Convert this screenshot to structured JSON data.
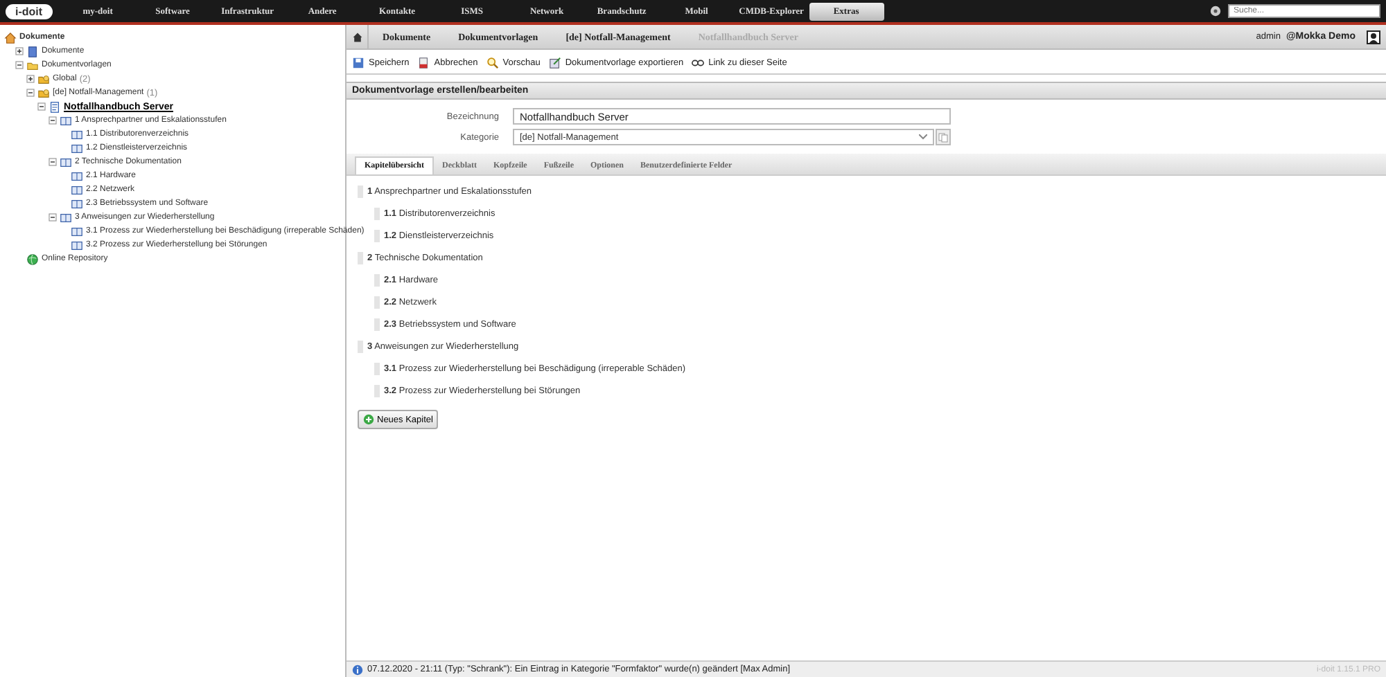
{
  "top_nav": {
    "logo": "i-doit",
    "items": [
      {
        "label": "my-doit",
        "selected": false
      },
      {
        "label": "Software",
        "selected": false
      },
      {
        "label": "Infrastruktur",
        "selected": false
      },
      {
        "label": "Andere",
        "selected": false
      },
      {
        "label": "Kontakte",
        "selected": false
      },
      {
        "label": "ISMS",
        "selected": false
      },
      {
        "label": "Network",
        "selected": false
      },
      {
        "label": "Brandschutz",
        "selected": false
      },
      {
        "label": "Mobil",
        "selected": false
      },
      {
        "label": "CMDB-Explorer",
        "selected": false
      },
      {
        "label": "Extras",
        "selected": true
      }
    ],
    "search": {
      "placeholder": "Suche..."
    }
  },
  "sidebar": {
    "tree": [
      {
        "label": "Dokumente",
        "kind": "home",
        "selected": false,
        "children": [
          {
            "label": "Dokumente",
            "kind": "doc",
            "expanded": false,
            "selected": false
          },
          {
            "label": "Dokumentvorlagen",
            "kind": "folder",
            "expanded": true,
            "selected": false,
            "children": [
              {
                "label": "Global",
                "count": "(2)",
                "kind": "box",
                "expanded": false,
                "selected": false
              },
              {
                "label": "[de] Notfall-Management",
                "count": "(1)",
                "kind": "box",
                "expanded": true,
                "selected": false,
                "children": [
                  {
                    "label": "Notfallhandbuch Server",
                    "kind": "template",
                    "expanded": true,
                    "selected": true,
                    "children": [
                      {
                        "label": "1 Ansprechpartner und Eskalationsstufen",
                        "kind": "chapter",
                        "expanded": true,
                        "selected": false,
                        "children": [
                          {
                            "label": "1.1 Distributorenverzeichnis",
                            "kind": "chapter",
                            "selected": false
                          },
                          {
                            "label": "1.2 Dienstleisterverzeichnis",
                            "kind": "chapter",
                            "selected": false
                          }
                        ]
                      },
                      {
                        "label": "2 Technische Dokumentation",
                        "kind": "chapter",
                        "expanded": true,
                        "selected": false,
                        "children": [
                          {
                            "label": "2.1 Hardware",
                            "kind": "chapter",
                            "selected": false
                          },
                          {
                            "label": "2.2 Netzwerk",
                            "kind": "chapter",
                            "selected": false
                          },
                          {
                            "label": "2.3 Betriebssystem und Software",
                            "kind": "chapter",
                            "selected": false
                          }
                        ]
                      },
                      {
                        "label": "3 Anweisungen zur Wiederherstellung",
                        "kind": "chapter",
                        "expanded": true,
                        "selected": false,
                        "children": [
                          {
                            "label": "3.1 Prozess zur Wiederherstellung bei Beschädigung (irreperable Schäden)",
                            "kind": "chapter",
                            "selected": false
                          },
                          {
                            "label": "3.2 Prozess zur Wiederherstellung bei Störungen",
                            "kind": "chapter",
                            "selected": false
                          }
                        ]
                      }
                    ]
                  }
                ]
              }
            ]
          },
          {
            "label": "Online Repository",
            "kind": "globe",
            "selected": false
          }
        ]
      }
    ]
  },
  "breadcrumb": {
    "items": [
      {
        "label": "Dokumente",
        "current": false
      },
      {
        "label": "Dokumentvorlagen",
        "current": false
      },
      {
        "label": "[de] Notfall-Management",
        "current": false
      },
      {
        "label": "Notfallhandbuch Server",
        "current": true
      }
    ],
    "user": "admin",
    "tenant": "@Mokka Demo"
  },
  "toolbar": [
    {
      "label": "Speichern",
      "kind": "save"
    },
    {
      "label": "Abbrechen",
      "kind": "cancel"
    },
    {
      "label": "Vorschau",
      "kind": "preview"
    },
    {
      "label": "Dokumentvorlage exportieren",
      "kind": "export"
    },
    {
      "label": "Link zu dieser Seite",
      "kind": "link"
    }
  ],
  "section_title": "Dokumentvorlage erstellen/bearbeiten",
  "form": {
    "bezeichnung": {
      "label": "Bezeichnung",
      "value": "Notfallhandbuch Server"
    },
    "kategorie": {
      "label": "Kategorie",
      "value": "[de] Notfall-Management"
    }
  },
  "tabs": [
    {
      "label": "Kapitelübersicht",
      "selected": true
    },
    {
      "label": "Deckblatt",
      "selected": false
    },
    {
      "label": "Kopfzeile",
      "selected": false
    },
    {
      "label": "Fußzeile",
      "selected": false
    },
    {
      "label": "Optionen",
      "selected": false
    },
    {
      "label": "Benutzerdefinierte Felder",
      "selected": false
    }
  ],
  "chapters": [
    {
      "number": "1",
      "title": "Ansprechpartner und Eskalationsstufen",
      "children": [
        {
          "number": "1.1",
          "title": "Distributorenverzeichnis"
        },
        {
          "number": "1.2",
          "title": "Dienstleisterverzeichnis"
        }
      ]
    },
    {
      "number": "2",
      "title": "Technische Dokumentation",
      "children": [
        {
          "number": "2.1",
          "title": "Hardware"
        },
        {
          "number": "2.2",
          "title": "Netzwerk"
        },
        {
          "number": "2.3",
          "title": "Betriebssystem und Software"
        }
      ]
    },
    {
      "number": "3",
      "title": "Anweisungen zur Wiederherstellung",
      "children": [
        {
          "number": "3.1",
          "title": "Prozess zur Wiederherstellung bei Beschädigung (irreperable Schäden)"
        },
        {
          "number": "3.2",
          "title": "Prozess zur Wiederherstellung bei Störungen"
        }
      ]
    }
  ],
  "new_chapter_button": "Neues Kapitel",
  "status_bar": {
    "message": "07.12.2020 - 21:11 (Typ: \"Schrank\"): Ein Eintrag in Kategorie \"Formfaktor\" wurde(n) geändert [Max Admin]",
    "version": "i-doit 1.15.1 PRO"
  }
}
